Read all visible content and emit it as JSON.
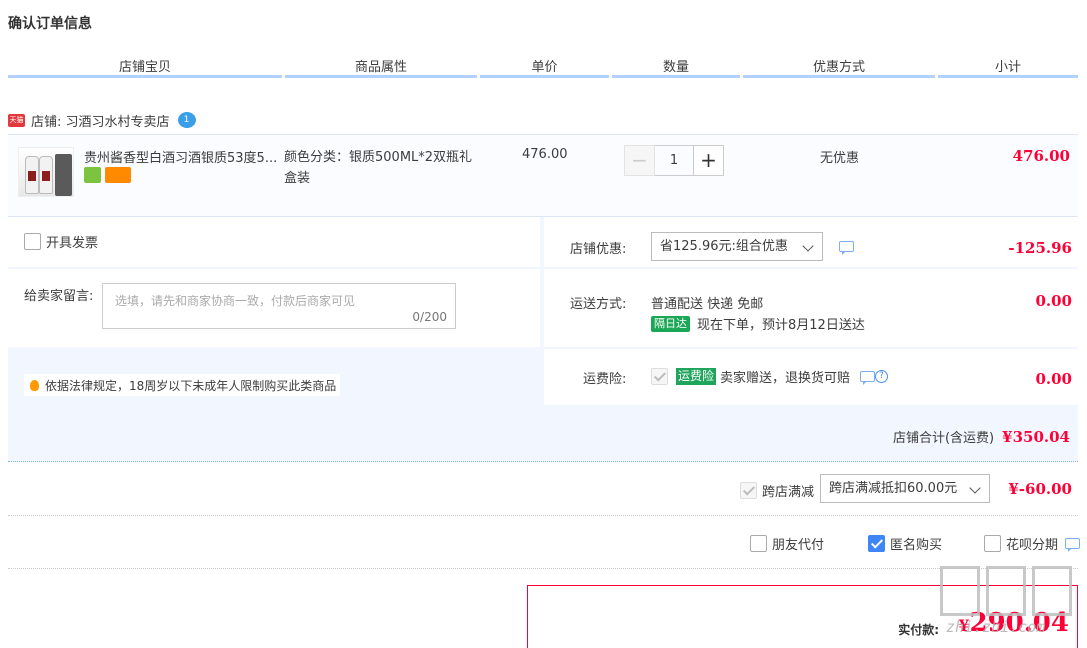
{
  "page_title": "确认订单信息",
  "columns": [
    "店铺宝贝",
    "商品属性",
    "单价",
    "数量",
    "优惠方式",
    "小计"
  ],
  "shop": {
    "badge": "天猫",
    "name": "店铺: 习酒习水村专卖店",
    "ww": "1"
  },
  "item": {
    "title": "贵州酱香型白酒习酒银质53度5...",
    "attr": "颜色分类：银质500ML*2双瓶礼盒装",
    "price": "476.00",
    "qty_minus": "−",
    "qty": "1",
    "qty_plus": "+",
    "promo": "无优惠",
    "subtotal": "476.00"
  },
  "options": {
    "invoice_label": "开具发票",
    "message_label": "给卖家留言:",
    "message_placeholder": "选填，请先和商家协商一致，付款后商家可见",
    "message_count": "0/200",
    "law_note": "依据法律规定，18周岁以下未成年人限制购买此类商品",
    "shop_coupon_label": "店铺优惠:",
    "shop_coupon_value": "省125.96元:组合优惠",
    "shop_coupon_amount": "-125.96",
    "shipping_label": "运送方式:",
    "shipping_value": "普通配送 快递 免邮",
    "next_day_tag": "隔日达",
    "next_day_text": "现在下单，预计8月12日送达",
    "shipping_amount": "0.00",
    "insurance_label": "运费险:",
    "insurance_tag": "运费险",
    "insurance_text": "卖家赠送，退换货可赔",
    "insurance_help": "?",
    "insurance_amount": "0.00",
    "shop_total_label": "店铺合计(含运费)",
    "shop_total_value": "¥350.04"
  },
  "cross_store": {
    "label": "跨店满减",
    "select_value": "跨店满减抵扣60.00元",
    "amount": "¥-60.00"
  },
  "payment_options": [
    {
      "label": "朋友代付",
      "checked": false
    },
    {
      "label": "匿名购买",
      "checked": true
    },
    {
      "label": "花呗分期",
      "checked": false
    }
  ],
  "total": {
    "label": "实付款:",
    "currency": "¥",
    "value": "290.04"
  },
  "watermark": "zhi.zhi.com",
  "colors": {
    "accent_red": "#ff0036",
    "header_line": "#b2d1ff",
    "panel_bg": "#f2f7ff",
    "check_blue": "#3e86f5"
  }
}
